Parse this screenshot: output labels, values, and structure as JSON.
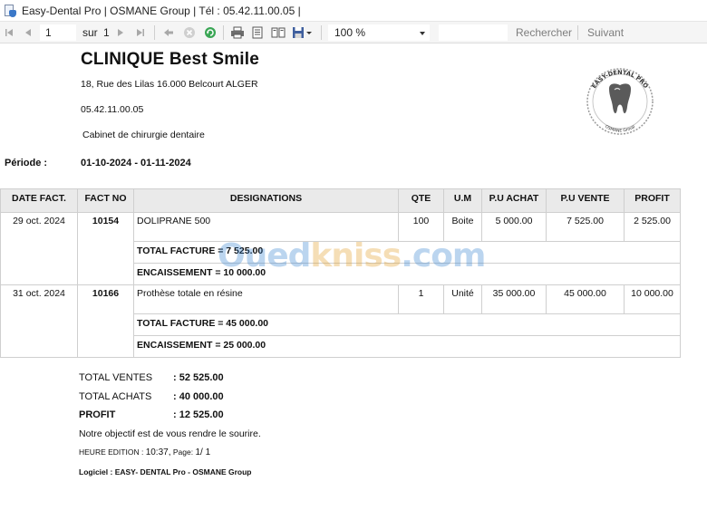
{
  "window": {
    "title": "Easy-Dental Pro |  OSMANE  Group  | Tél : 05.42.11.00.05 |"
  },
  "toolbar": {
    "page_value": "1",
    "of_label": "sur",
    "page_total": "1",
    "zoom_value": "100 %",
    "search_label": "Rechercher",
    "next_label": "Suivant"
  },
  "report": {
    "clinic_name": "CLINIQUE  Best Smile",
    "address": "18, Rue des Lilas 16.000  Belcourt  ALGER",
    "phone": "05.42.11.00.05",
    "specialty": "Cabinet de chirurgie dentaire",
    "period_label": "Période   :",
    "period_value": "01-10-2024 - 01-11-2024",
    "logo_top_text": "EASY-DENTAL PRO",
    "logo_bottom_text": "OSMANE Group",
    "columns": [
      "DATE FACT.",
      "FACT NO",
      "DESIGNATIONS",
      "QTE",
      "U.M",
      "P.U ACHAT",
      "P.U VENTE",
      "PROFIT"
    ],
    "invoices": [
      {
        "date": "29 oct. 2024",
        "number": "10154",
        "designation": "DOLIPRANE 500",
        "qty": "100",
        "unit": "Boite",
        "pu_achat": "5 000.00",
        "pu_vente": "7 525.00",
        "profit": "2 525.00",
        "total_facture": "TOTAL FACTURE = 7 525.00",
        "encaissement": "ENCAISSEMENT  =  10 000.00"
      },
      {
        "date": "31 oct. 2024",
        "number": "10166",
        "designation": "Prothèse totale en résine",
        "qty": "1",
        "unit": "Unité",
        "pu_achat": "35 000.00",
        "pu_vente": "45 000.00",
        "profit": "10 000.00",
        "total_facture": "TOTAL FACTURE = 45 000.00",
        "encaissement": "ENCAISSEMENT  =  25 000.00"
      }
    ],
    "totals": {
      "ventes_label": "TOTAL VENTES",
      "ventes_value": ": 52 525.00",
      "achats_label": "TOTAL ACHATS",
      "achats_value": ": 40 000.00",
      "profit_label": "PROFIT",
      "profit_value": ": 12 525.00"
    },
    "slogan": "Notre objectif est de vous rendre le sourire.",
    "edition_label": "HEURE EDITION :",
    "edition_time": "10:37,",
    "page_label": "Page:",
    "page_value": "1/ 1",
    "software_label": "Logiciel :",
    "software_value": "EASY- DENTAL Pro - OSMANE Group"
  },
  "watermark": {
    "part1": "Oued",
    "part2": "kniss",
    "part3": ".com"
  }
}
